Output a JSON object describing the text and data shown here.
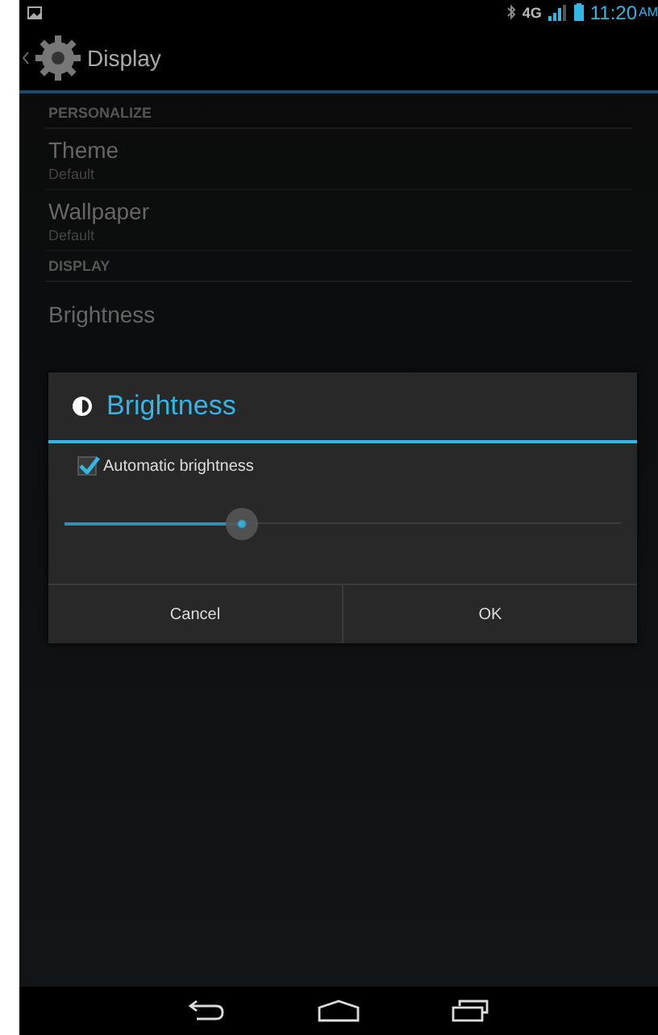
{
  "status_bar": {
    "time": "11:20",
    "ampm": "AM",
    "network": "4G"
  },
  "action_bar": {
    "title": "Display"
  },
  "sections": [
    {
      "header": "PERSONALIZE",
      "items": [
        {
          "title": "Theme",
          "summary": "Default"
        },
        {
          "title": "Wallpaper",
          "summary": "Default"
        }
      ]
    },
    {
      "header": "DISPLAY",
      "items": [
        {
          "title": "Brightness"
        }
      ]
    }
  ],
  "dialog": {
    "title": "Brightness",
    "checkbox": {
      "label": "Automatic brightness",
      "checked": true
    },
    "slider": {
      "level": 0.32
    },
    "buttons": [
      "Cancel",
      "OK"
    ]
  }
}
